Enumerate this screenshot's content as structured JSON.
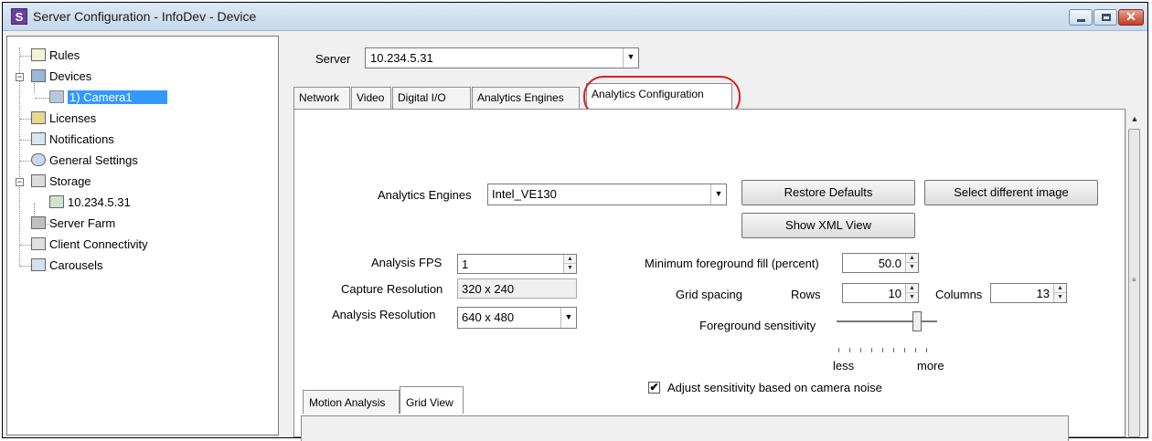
{
  "window": {
    "title": "Server Configuration - InfoDev - Device",
    "app_icon_letter": "S"
  },
  "tree": {
    "items": [
      {
        "label": "Rules",
        "icon": "rules-icon"
      },
      {
        "label": "Devices",
        "icon": "devices-icon"
      },
      {
        "label": "1) Camera1",
        "icon": "camera-icon",
        "selected": true
      },
      {
        "label": "Licenses",
        "icon": "licenses-icon"
      },
      {
        "label": "Notifications",
        "icon": "notifications-icon"
      },
      {
        "label": "General Settings",
        "icon": "general-settings-icon"
      },
      {
        "label": "Storage",
        "icon": "storage-icon"
      },
      {
        "label": "10.234.5.31",
        "icon": "storage-server-icon"
      },
      {
        "label": "Server Farm",
        "icon": "server-farm-icon"
      },
      {
        "label": "Client Connectivity",
        "icon": "client-connectivity-icon"
      },
      {
        "label": "Carousels",
        "icon": "carousels-icon"
      }
    ]
  },
  "server": {
    "label": "Server",
    "value": "10.234.5.31"
  },
  "tabs": [
    {
      "label": "Network"
    },
    {
      "label": "Video"
    },
    {
      "label": "Digital I/O"
    },
    {
      "label": "Analytics Engines"
    },
    {
      "label": "Analytics Configuration",
      "active": true
    }
  ],
  "config": {
    "analytics_engines_label": "Analytics Engines",
    "analytics_engines_value": "Intel_VE130",
    "restore_defaults": "Restore Defaults",
    "select_image": "Select different image",
    "show_xml": "Show XML View",
    "analysis_fps_label": "Analysis FPS",
    "analysis_fps_value": "1",
    "capture_res_label": "Capture Resolution",
    "capture_res_value": "320 x 240",
    "analysis_res_label": "Analysis Resolution",
    "analysis_res_value": "640 x 480",
    "min_fill_label": "Minimum foreground fill (percent)",
    "min_fill_value": "50.0",
    "grid_spacing_label": "Grid spacing",
    "rows_label": "Rows",
    "rows_value": "10",
    "columns_label": "Columns",
    "columns_value": "13",
    "sensitivity_label": "Foreground sensitivity",
    "sensitivity_level": 0.8,
    "less_label": "less",
    "more_label": "more",
    "adjust_label": "Adjust sensitivity based on camera noise",
    "adjust_checked": true
  },
  "subtabs": [
    {
      "label": "Motion Analysis"
    },
    {
      "label": "Grid View",
      "active": true
    }
  ],
  "colors": {
    "selection": "#3399ff",
    "highlight_circle": "#d42020"
  }
}
